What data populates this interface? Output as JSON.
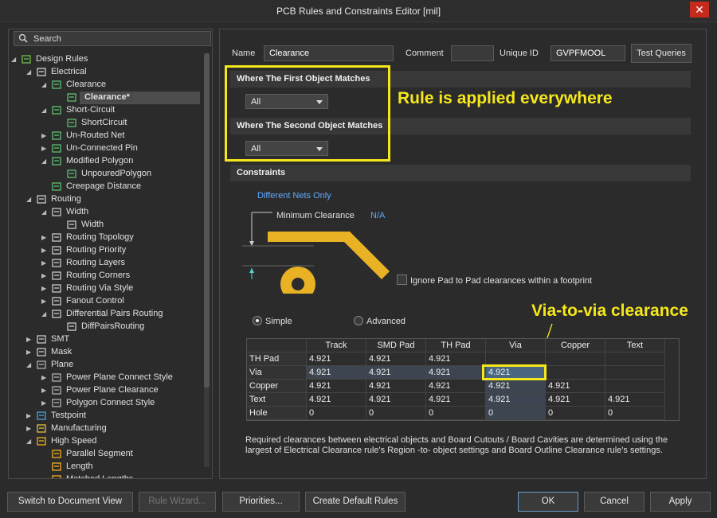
{
  "window": {
    "title": "PCB Rules and Constraints Editor [mil]",
    "close_symbol": "✕"
  },
  "search": {
    "label": "Search"
  },
  "tree": [
    {
      "label": "Design Rules",
      "level": 0,
      "arrow": "expanded",
      "icon": "design-rules-icon"
    },
    {
      "label": "Electrical",
      "level": 1,
      "arrow": "expanded",
      "icon": "electrical-icon"
    },
    {
      "label": "Clearance",
      "level": 2,
      "arrow": "expanded",
      "icon": "rule-icon"
    },
    {
      "label": "Clearance*",
      "level": 3,
      "arrow": "none",
      "icon": "rule-icon",
      "selected": true
    },
    {
      "label": "Short-Circuit",
      "level": 2,
      "arrow": "expanded",
      "icon": "rule-icon"
    },
    {
      "label": "ShortCircuit",
      "level": 3,
      "arrow": "none",
      "icon": "rule-icon"
    },
    {
      "label": "Un-Routed Net",
      "level": 2,
      "arrow": "collapsed",
      "icon": "rule-icon"
    },
    {
      "label": "Un-Connected Pin",
      "level": 2,
      "arrow": "collapsed",
      "icon": "rule-icon"
    },
    {
      "label": "Modified Polygon",
      "level": 2,
      "arrow": "expanded",
      "icon": "rule-icon"
    },
    {
      "label": "UnpouredPolygon",
      "level": 3,
      "arrow": "none",
      "icon": "rule-icon"
    },
    {
      "label": "Creepage Distance",
      "level": 2,
      "arrow": "none",
      "icon": "rule-icon"
    },
    {
      "label": "Routing",
      "level": 1,
      "arrow": "expanded",
      "icon": "routing-icon"
    },
    {
      "label": "Width",
      "level": 2,
      "arrow": "expanded",
      "icon": "routing-icon"
    },
    {
      "label": "Width",
      "level": 3,
      "arrow": "none",
      "icon": "routing-icon"
    },
    {
      "label": "Routing Topology",
      "level": 2,
      "arrow": "collapsed",
      "icon": "routing-icon"
    },
    {
      "label": "Routing Priority",
      "level": 2,
      "arrow": "collapsed",
      "icon": "routing-icon"
    },
    {
      "label": "Routing Layers",
      "level": 2,
      "arrow": "collapsed",
      "icon": "routing-icon"
    },
    {
      "label": "Routing Corners",
      "level": 2,
      "arrow": "collapsed",
      "icon": "routing-icon"
    },
    {
      "label": "Routing Via Style",
      "level": 2,
      "arrow": "collapsed",
      "icon": "routing-icon"
    },
    {
      "label": "Fanout Control",
      "level": 2,
      "arrow": "collapsed",
      "icon": "routing-icon"
    },
    {
      "label": "Differential Pairs Routing",
      "level": 2,
      "arrow": "expanded",
      "icon": "routing-icon"
    },
    {
      "label": "DiffPairsRouting",
      "level": 3,
      "arrow": "none",
      "icon": "routing-icon"
    },
    {
      "label": "SMT",
      "level": 1,
      "arrow": "collapsed",
      "icon": "smt-icon"
    },
    {
      "label": "Mask",
      "level": 1,
      "arrow": "collapsed",
      "icon": "mask-icon"
    },
    {
      "label": "Plane",
      "level": 1,
      "arrow": "expanded",
      "icon": "plane-icon"
    },
    {
      "label": "Power Plane Connect Style",
      "level": 2,
      "arrow": "collapsed",
      "icon": "plane-icon"
    },
    {
      "label": "Power Plane Clearance",
      "level": 2,
      "arrow": "collapsed",
      "icon": "plane-icon"
    },
    {
      "label": "Polygon Connect Style",
      "level": 2,
      "arrow": "collapsed",
      "icon": "plane-icon"
    },
    {
      "label": "Testpoint",
      "level": 1,
      "arrow": "collapsed",
      "icon": "testpoint-icon"
    },
    {
      "label": "Manufacturing",
      "level": 1,
      "arrow": "collapsed",
      "icon": "manufacturing-icon"
    },
    {
      "label": "High Speed",
      "level": 1,
      "arrow": "expanded",
      "icon": "highspeed-icon"
    },
    {
      "label": "Parallel Segment",
      "level": 2,
      "arrow": "none",
      "icon": "highspeed-icon"
    },
    {
      "label": "Length",
      "level": 2,
      "arrow": "none",
      "icon": "highspeed-icon"
    },
    {
      "label": "Matched Lengths",
      "level": 2,
      "arrow": "none",
      "icon": "highspeed-icon"
    }
  ],
  "rule": {
    "name_label": "Name",
    "name_value": "Clearance",
    "comment_label": "Comment",
    "comment_value": "",
    "uid_label": "Unique ID",
    "uid_value": "GVPFMOOL",
    "test_queries": "Test Queries"
  },
  "first_match": {
    "heading": "Where The First Object Matches",
    "value": "All"
  },
  "second_match": {
    "heading": "Where The Second Object Matches",
    "value": "All"
  },
  "constraints": {
    "heading": "Constraints",
    "net_scope": "Different Nets Only",
    "min_clearance_label": "Minimum Clearance",
    "min_clearance_value": "N/A",
    "ignore_pad_label": "Ignore Pad to Pad clearances within a footprint",
    "mode_simple": "Simple",
    "mode_advanced": "Advanced",
    "selected_mode": "Simple"
  },
  "annotations": {
    "rule_applied": "Rule is applied everywhere",
    "via_clearance": "Via-to-via clearance"
  },
  "clearance_table": {
    "columns": [
      "",
      "Track",
      "SMD Pad",
      "TH Pad",
      "Via",
      "Copper",
      "Text"
    ],
    "rows": [
      {
        "name": "TH Pad",
        "cells": [
          "4.921",
          "4.921",
          "4.921",
          "",
          "",
          ""
        ]
      },
      {
        "name": "Via",
        "cells": [
          "4.921",
          "4.921",
          "4.921",
          "4.921",
          "",
          ""
        ]
      },
      {
        "name": "Copper",
        "cells": [
          "4.921",
          "4.921",
          "4.921",
          "4.921",
          "4.921",
          ""
        ]
      },
      {
        "name": "Text",
        "cells": [
          "4.921",
          "4.921",
          "4.921",
          "4.921",
          "4.921",
          "4.921"
        ]
      },
      {
        "name": "Hole",
        "cells": [
          "0",
          "0",
          "0",
          "0",
          "0",
          "0"
        ]
      }
    ]
  },
  "note": "Required clearances between electrical objects and Board Cutouts / Board Cavities are determined using the largest of Electrical Clearance rule's Region -to- object settings and Board Outline Clearance rule's settings.",
  "footer": {
    "switch_view": "Switch to Document View",
    "rule_wizard": "Rule Wizard...",
    "priorities": "Priorities...",
    "create_defaults": "Create Default Rules",
    "ok": "OK",
    "cancel": "Cancel",
    "apply": "Apply"
  },
  "colors": {
    "highlight": "#f5e71b",
    "trace": "#e8b224",
    "selected_cell": "#4a6782"
  }
}
